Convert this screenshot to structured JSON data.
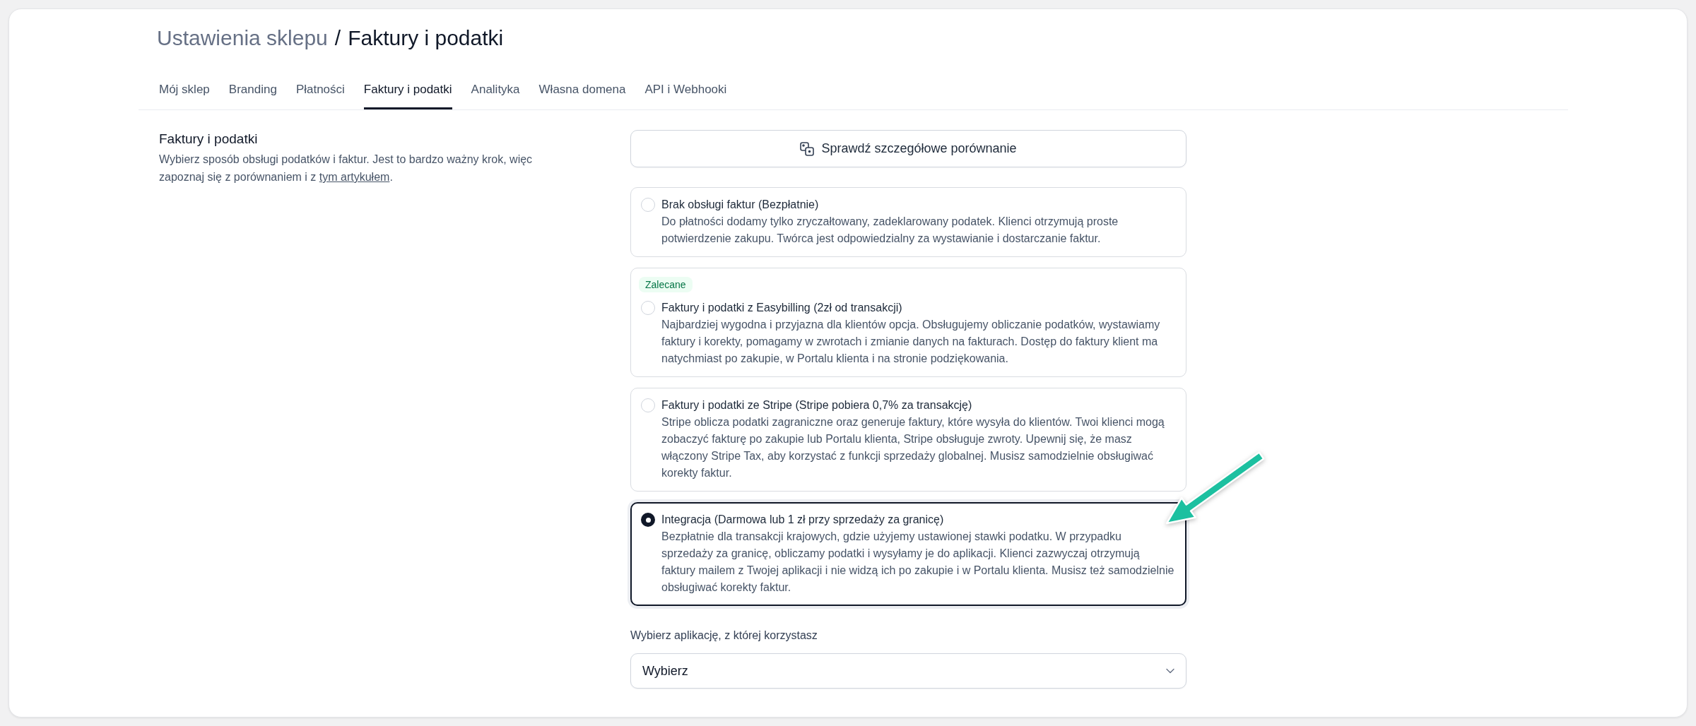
{
  "breadcrumb": {
    "parent": "Ustawienia sklepu",
    "separator": "/",
    "current": "Faktury i podatki"
  },
  "tabs": [
    {
      "label": "Mój sklep",
      "selected": false
    },
    {
      "label": "Branding",
      "selected": false
    },
    {
      "label": "Płatności",
      "selected": false
    },
    {
      "label": "Faktury i podatki",
      "selected": true
    },
    {
      "label": "Analityka",
      "selected": false
    },
    {
      "label": "Własna domena",
      "selected": false
    },
    {
      "label": "API i Webhooki",
      "selected": false
    }
  ],
  "section": {
    "title": "Faktury i podatki",
    "description": "Wybierz sposób obsługi podatków i faktur. Jest to bardzo ważny krok, więc zapoznaj się z porównaniem i z",
    "link": "tym artykułem",
    "description_end": "."
  },
  "compare_button": {
    "label": "Sprawdź szczegółowe porównanie"
  },
  "options": [
    {
      "title": "Brak obsługi faktur (Bezpłatnie)",
      "description": "Do płatności dodamy tylko zryczałtowany, zadeklarowany podatek. Klienci otrzymują proste potwierdzenie zakupu. Twórca jest odpowiedzialny za wystawianie i dostarczanie faktur.",
      "selected": false
    },
    {
      "badge": "Zalecane",
      "title": "Faktury i podatki z Easybilling (2zł od transakcji)",
      "description": "Najbardziej wygodna i przyjazna dla klientów opcja. Obsługujemy obliczanie podatków, wystawiamy faktury i korekty, pomagamy w zwrotach i zmianie danych na fakturach. Dostęp do faktury klient ma natychmiast po zakupie, w Portalu klienta i na stronie podziękowania.",
      "selected": false
    },
    {
      "title": "Faktury i podatki ze Stripe (Stripe pobiera 0,7% za transakcję)",
      "description": "Stripe oblicza podatki zagraniczne oraz generuje faktury, które wysyła do klientów. Twoi klienci mogą zobaczyć fakturę po zakupie lub Portalu klienta, Stripe obsługuje zwroty. Upewnij się, że masz włączony Stripe Tax, aby korzystać z funkcji sprzedaży globalnej. Musisz samodzielnie obsługiwać korekty faktur.",
      "selected": false
    },
    {
      "title": "Integracja (Darmowa lub 1 zł przy sprzedaży za granicę)",
      "description": "Bezpłatnie dla transakcji krajowych, gdzie użyjemy ustawionej stawki podatku. W przypadku sprzedaży za granicę, obliczamy podatki i wysyłamy je do aplikacji. Klienci zazwyczaj otrzymują faktury mailem z Twojej aplikacji i nie widzą ich po zakupie i w Portalu klienta. Musisz też samodzielnie obsługiwać korekty faktur.",
      "selected": true
    }
  ],
  "app_select": {
    "label": "Wybierz aplikację, z której korzystasz",
    "placeholder": "Wybierz"
  }
}
